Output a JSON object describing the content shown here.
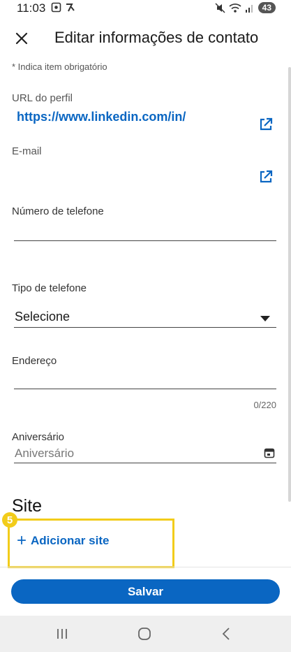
{
  "status_bar": {
    "time": "11:03",
    "battery": "43"
  },
  "header": {
    "title": "Editar informações de contato"
  },
  "form": {
    "required_note": "* Indica item obrigatório",
    "profile_url_label": "URL do perfil",
    "profile_url_value": "https://www.linkedin.com/in/",
    "email_label": "E-mail",
    "phone_label": "Número de telefone",
    "phone_type_label": "Tipo de telefone",
    "phone_type_value": "Selecione",
    "address_label": "Endereço",
    "address_counter": "0/220",
    "birthday_label": "Aniversário",
    "birthday_placeholder": "Aniversário"
  },
  "site": {
    "heading": "Site",
    "add_label": "Adicionar site",
    "step_badge": "5"
  },
  "footer": {
    "save_label": "Salvar"
  },
  "colors": {
    "accent": "#0a66c2",
    "highlight": "#f2cc1a"
  }
}
